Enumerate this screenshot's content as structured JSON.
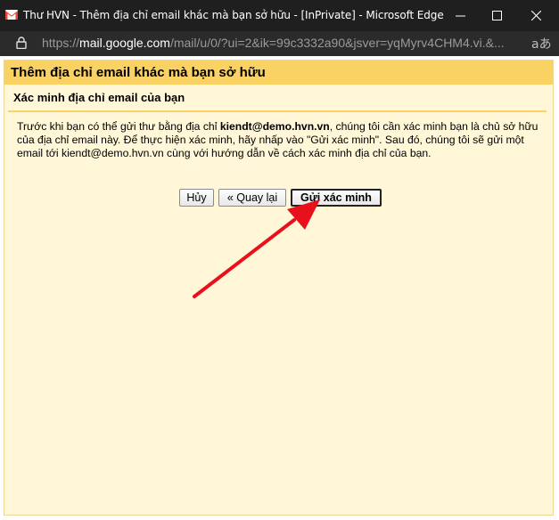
{
  "window": {
    "title": "Thư HVN - Thêm địa chỉ email khác mà bạn sở hữu - [InPrivate] - Microsoft Edge",
    "minimize_glyph": "—",
    "maximize_glyph": "☐",
    "close_glyph": "✕"
  },
  "addressbar": {
    "protocol": "https://",
    "host": "mail.google.com",
    "path": "/mail/u/0/?ui=2&ik=99c3332a90&jsver=yqMyrv4CHM4.vi.&...",
    "reader_glyph": "aあ"
  },
  "dialog": {
    "title": "Thêm địa chỉ email khác mà bạn sở hữu",
    "subtitle": "Xác minh địa chỉ email của bạn",
    "message_part1": "Trước khi bạn có thể gửi thư bằng địa chỉ ",
    "message_email_bold": "kiendt@demo.hvn.vn",
    "message_part2": ", chúng tôi cần xác minh bạn là chủ sở hữu của địa chỉ email này. Để thực hiện xác minh, hãy nhấp vào \"Gửi xác minh\". Sau đó, chúng tôi sẽ gửi một email tới kiendt@demo.hvn.vn cùng với hướng dẫn về cách xác minh địa chỉ của bạn.",
    "cancel_label": "Hủy",
    "back_label": "« Quay lại",
    "send_verification_label": "Gửi xác minh"
  },
  "colors": {
    "header": "#fad163",
    "dialog_bg": "#fff7d7",
    "arrow": "#e8101a"
  },
  "icons": {
    "app": "gmail-icon",
    "lock": "lock-icon",
    "annotation": "red-arrow"
  }
}
